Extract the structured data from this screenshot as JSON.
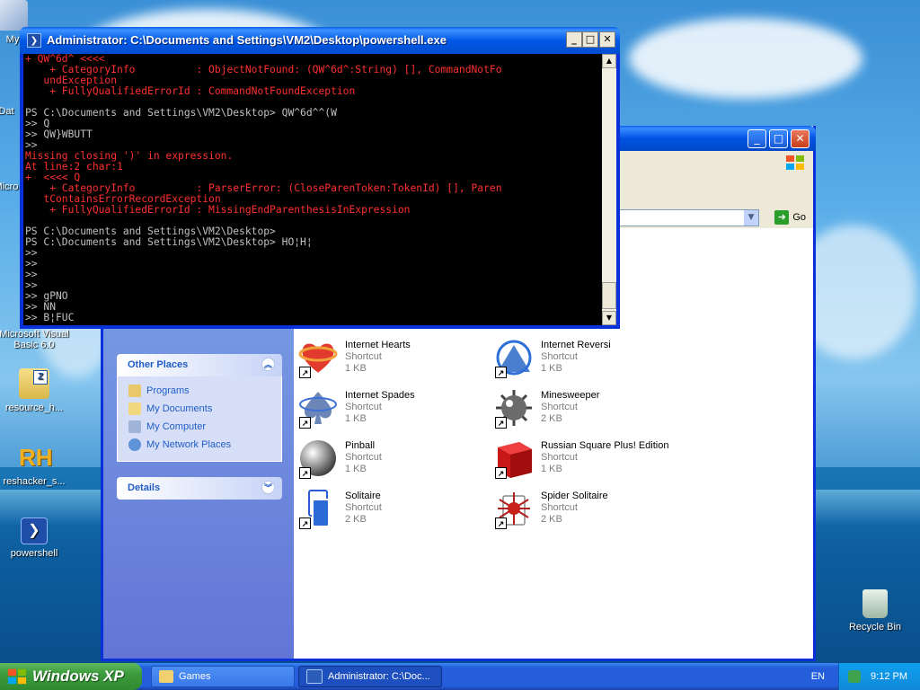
{
  "desktop": {
    "icons": [
      {
        "label": "My",
        "icon": "my-computer-icon"
      },
      {
        "label": "Dat",
        "icon": "database-icon"
      },
      {
        "label": "Micro",
        "icon": "app-icon"
      },
      {
        "label": "Microsoft Visual Basic 6.0",
        "icon": "visual-basic-icon"
      },
      {
        "label": "resource_h...",
        "icon": "zip-archive-icon"
      },
      {
        "label": "reshacker_s...",
        "icon": "reshacker-icon"
      },
      {
        "label": "powershell",
        "icon": "powershell-icon"
      },
      {
        "label": "Recycle Bin",
        "icon": "recycle-bin-icon"
      }
    ]
  },
  "powershell": {
    "title": "Administrator: C:\\Documents and Settings\\VM2\\Desktop\\powershell.exe",
    "controls": {
      "minimize": "_",
      "maximize": "□",
      "close": "✕"
    },
    "lines": [
      {
        "text": "+ QW^6d^ <<<<",
        "color": "r"
      },
      {
        "text": "    + CategoryInfo          : ObjectNotFound: (QW^6d^:String) [], CommandNotFo",
        "color": "r"
      },
      {
        "text": "   undException",
        "color": "r"
      },
      {
        "text": "    + FullyQualifiedErrorId : CommandNotFoundException",
        "color": "r"
      },
      {
        "text": "",
        "color": "w"
      },
      {
        "text": "PS C:\\Documents and Settings\\VM2\\Desktop> QW^6d^^(W",
        "color": "w"
      },
      {
        "text": ">> Q",
        "color": "w"
      },
      {
        "text": ">> QW}WBUTT",
        "color": "w"
      },
      {
        "text": ">>",
        "color": "w"
      },
      {
        "text": "Missing closing ')' in expression.",
        "color": "r"
      },
      {
        "text": "At line:2 char:1",
        "color": "r"
      },
      {
        "text": "+  <<<< Q",
        "color": "r"
      },
      {
        "text": "    + CategoryInfo          : ParserError: (CloseParenToken:TokenId) [], Paren",
        "color": "r"
      },
      {
        "text": "   tContainsErrorRecordException",
        "color": "r"
      },
      {
        "text": "    + FullyQualifiedErrorId : MissingEndParenthesisInExpression",
        "color": "r"
      },
      {
        "text": "",
        "color": "w"
      },
      {
        "text": "PS C:\\Documents and Settings\\VM2\\Desktop>",
        "color": "w"
      },
      {
        "text": "PS C:\\Documents and Settings\\VM2\\Desktop> HO¦H¦",
        "color": "w"
      },
      {
        "text": ">>",
        "color": "w"
      },
      {
        "text": ">>",
        "color": "w"
      },
      {
        "text": ">>",
        "color": "w"
      },
      {
        "text": ">>",
        "color": "w"
      },
      {
        "text": ">> gPNO",
        "color": "w"
      },
      {
        "text": ">> NN",
        "color": "w"
      },
      {
        "text": ">> B¦FUC",
        "color": "w"
      }
    ]
  },
  "explorer": {
    "address": {
      "go_label": "Go"
    },
    "other_places": {
      "title": "Other Places",
      "links": [
        {
          "label": "Programs",
          "icon": "programs-folder-icon"
        },
        {
          "label": "My Documents",
          "icon": "my-documents-icon"
        },
        {
          "label": "My Computer",
          "icon": "my-computer-icon"
        },
        {
          "label": "My Network Places",
          "icon": "network-places-icon"
        }
      ]
    },
    "details": {
      "title": "Details"
    },
    "files": [
      {
        "name": "Internet Hearts",
        "type": "Shortcut",
        "size": "1 KB",
        "icon": "hearts-icon"
      },
      {
        "name": "Internet Reversi",
        "type": "Shortcut",
        "size": "1 KB",
        "icon": "reversi-icon"
      },
      {
        "name": "Internet Spades",
        "type": "Shortcut",
        "size": "1 KB",
        "icon": "spades-icon"
      },
      {
        "name": "Minesweeper",
        "type": "Shortcut",
        "size": "2 KB",
        "icon": "minesweeper-icon"
      },
      {
        "name": "Pinball",
        "type": "Shortcut",
        "size": "1 KB",
        "icon": "pinball-icon"
      },
      {
        "name": "Russian Square Plus! Edition",
        "type": "Shortcut",
        "size": "1 KB",
        "icon": "russian-square-icon"
      },
      {
        "name": "Solitaire",
        "type": "Shortcut",
        "size": "2 KB",
        "icon": "solitaire-icon"
      },
      {
        "name": "Spider Solitaire",
        "type": "Shortcut",
        "size": "2 KB",
        "icon": "spider-solitaire-icon"
      }
    ]
  },
  "taskbar": {
    "start_label": "Windows XP",
    "buttons": [
      {
        "label": "Games",
        "icon": "folder-icon",
        "active": false
      },
      {
        "label": "Administrator: C:\\Doc...",
        "icon": "powershell-icon",
        "active": true
      }
    ],
    "language": "EN",
    "clock": "9:12 PM"
  }
}
